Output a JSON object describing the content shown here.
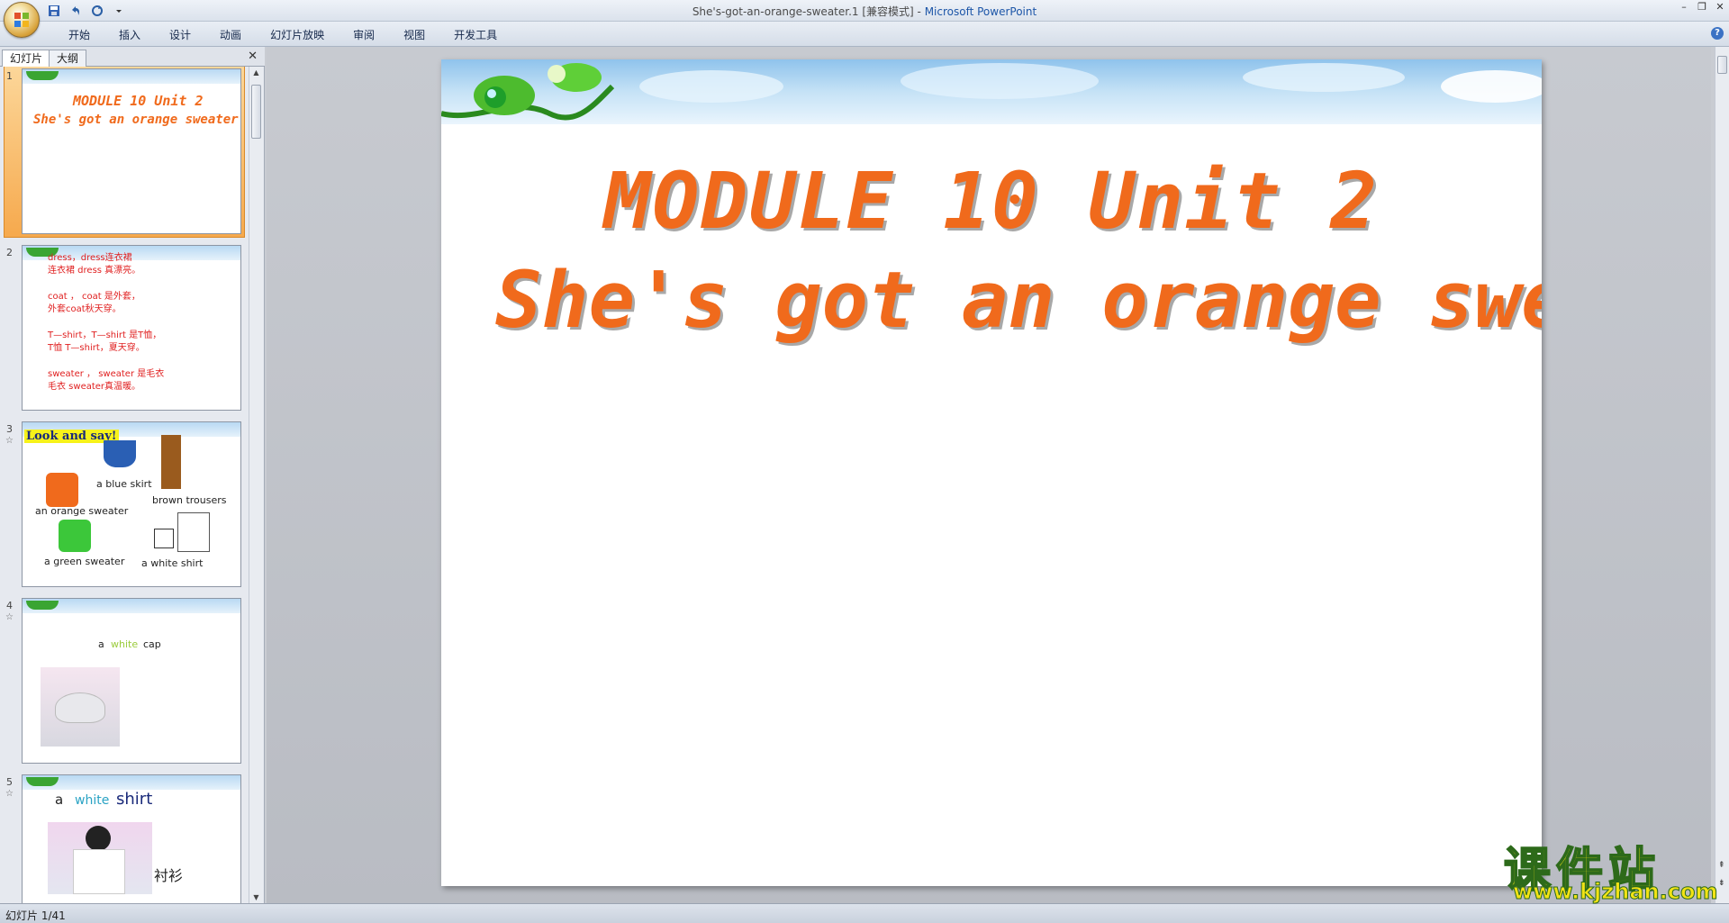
{
  "window": {
    "title": "She's-got-an-orange-sweater.1 [兼容模式] - ",
    "app_name": "Microsoft PowerPoint"
  },
  "qat": {
    "save_icon": "save-icon",
    "undo_icon": "undo-icon",
    "redo_icon": "redo-icon",
    "customize_icon": "dropdown-arrow-icon"
  },
  "ribbon": {
    "tabs": [
      "开始",
      "插入",
      "设计",
      "动画",
      "幻灯片放映",
      "审阅",
      "视图",
      "开发工具"
    ]
  },
  "left_pane": {
    "tabs": [
      "幻灯片",
      "大纲"
    ],
    "close": "✕"
  },
  "thumbnails": [
    {
      "num": "1",
      "line1": "MODULE 10 Unit 2",
      "line2": "She's got an orange sweater."
    },
    {
      "num": "2",
      "lines": [
        "dress，dress连衣裙",
        "连衣裙 dress 真漂亮。",
        "coat ， coat 是外套，",
        "外套coat秋天穿。",
        "T—shirt，T—shirt 是T恤，",
        "T恤 T—shirt，夏天穿。",
        "sweater ， sweater 是毛衣",
        "毛衣 sweater真温暖。"
      ]
    },
    {
      "num": "3",
      "star": "☆",
      "heading": "Look and say!",
      "labels": [
        "a blue skirt",
        "brown trousers",
        "an orange sweater",
        "a green sweater",
        "a white shirt"
      ]
    },
    {
      "num": "4",
      "star": "☆",
      "caption_a": "a",
      "caption_white": "white",
      "caption_cap": "cap"
    },
    {
      "num": "5",
      "star": "☆",
      "caption_a": "a",
      "caption_white": "white",
      "caption_shirt": "shirt",
      "cn": "衬衫"
    }
  ],
  "slide": {
    "title1": "MODULE 10 Unit 2",
    "title2": "She's got an orange sweater."
  },
  "status": {
    "text": "幻灯片 1/41"
  },
  "watermark": {
    "cn": "课件站",
    "url": "www.kjzhan.com"
  }
}
